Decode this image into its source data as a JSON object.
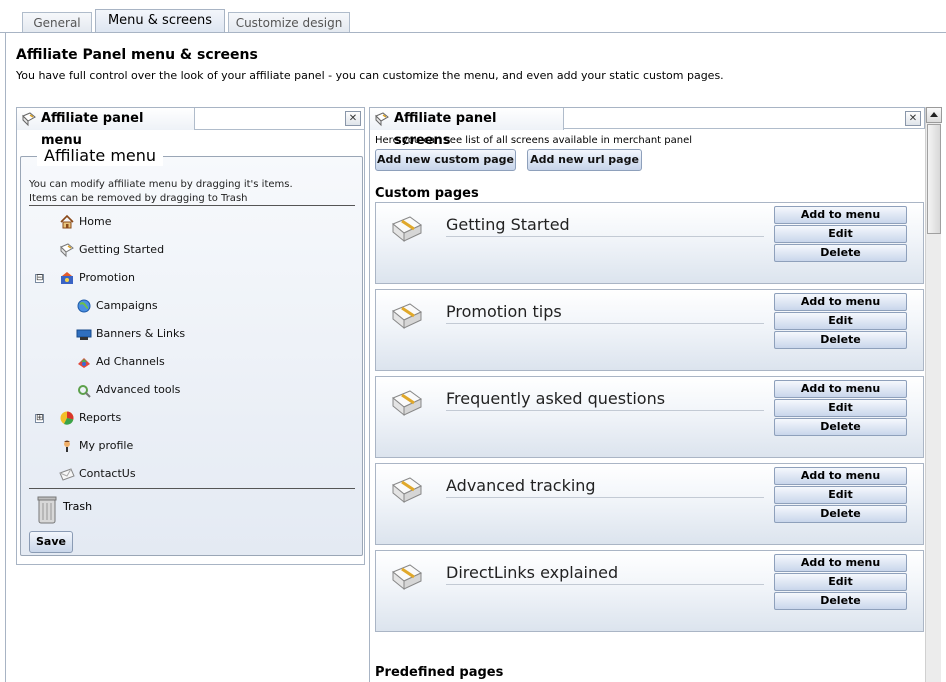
{
  "tabs": [
    {
      "label": "General",
      "active": false
    },
    {
      "label": "Menu & screens",
      "active": true
    },
    {
      "label": "Customize design",
      "active": false
    }
  ],
  "page": {
    "title": "Affiliate Panel menu & screens",
    "description": "You have full control over the look of your affiliate panel - you can customize the menu, and even add your static custom pages."
  },
  "menu_panel": {
    "tab_label": "Affiliate panel menu",
    "close_label": "✕",
    "legend": "Affiliate menu",
    "hint_line1": "You can modify affiliate menu by dragging it's items.",
    "hint_line2": "Items can be removed by dragging to Trash",
    "items": [
      {
        "label": "Home",
        "icon": "home-icon"
      },
      {
        "label": "Getting Started",
        "icon": "page-icon"
      },
      {
        "label": "Promotion",
        "icon": "promotion-icon",
        "toggle": "⊟"
      },
      {
        "label": "Campaigns",
        "icon": "globe-icon"
      },
      {
        "label": "Banners & Links",
        "icon": "banner-icon"
      },
      {
        "label": "Ad Channels",
        "icon": "channels-icon"
      },
      {
        "label": "Advanced tools",
        "icon": "tools-icon"
      },
      {
        "label": "Reports",
        "icon": "reports-icon",
        "toggle": "⊞"
      },
      {
        "label": "My profile",
        "icon": "user-icon"
      },
      {
        "label": "ContactUs",
        "icon": "envelope-icon"
      }
    ],
    "trash_label": "Trash",
    "save_label": "Save"
  },
  "screens_panel": {
    "tab_label": "Affiliate panel screens",
    "close_label": "✕",
    "hint": "Here you can see list of all screens available in merchant panel",
    "add_custom_label": "Add new custom page",
    "add_url_label": "Add new url page",
    "custom_pages_title": "Custom pages",
    "custom_pages": [
      {
        "title": "Getting Started"
      },
      {
        "title": "Promotion tips"
      },
      {
        "title": "Frequently asked questions"
      },
      {
        "title": "Advanced tracking"
      },
      {
        "title": "DirectLinks explained"
      }
    ],
    "card_buttons": {
      "add": "Add to menu",
      "edit": "Edit",
      "delete": "Delete"
    },
    "predefined_pages_title": "Predefined pages"
  },
  "colors": {
    "accent": "#c6d4ea",
    "border": "#a8b4c4"
  }
}
